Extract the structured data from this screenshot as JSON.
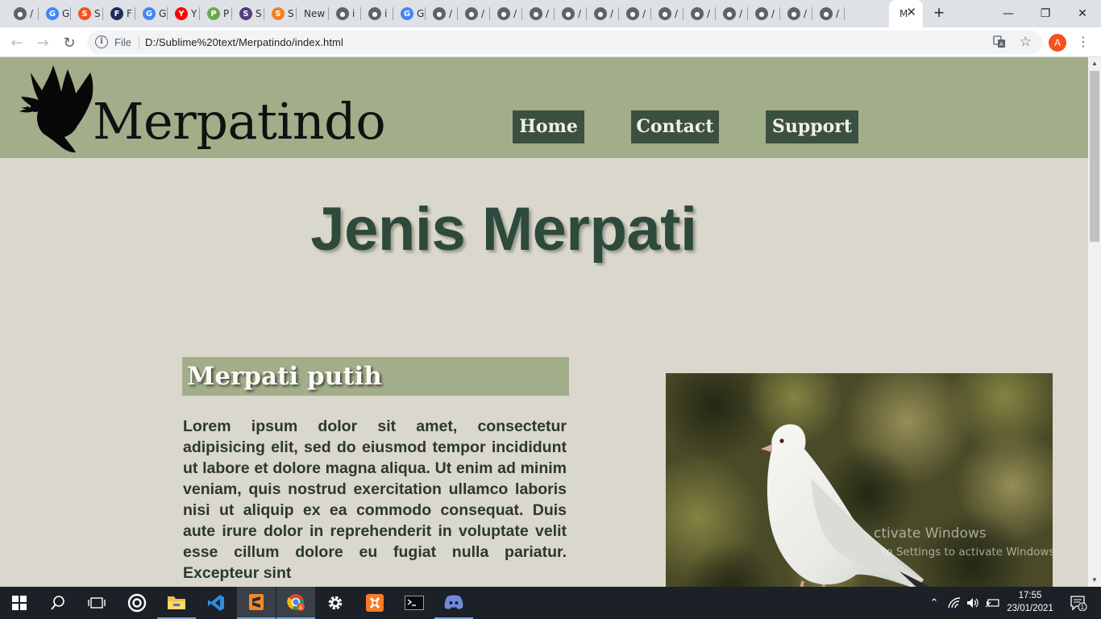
{
  "browser": {
    "tabs": [
      {
        "label": "/",
        "icon": "globe-icon",
        "color": "#5f6368"
      },
      {
        "label": "G",
        "icon": "google-icon",
        "color": "#4285f4"
      },
      {
        "label": "S",
        "icon": "flower-icon",
        "color": "#f4511e"
      },
      {
        "label": "F",
        "icon": "site-icon",
        "color": "#1f2d5c"
      },
      {
        "label": "G",
        "icon": "google-icon",
        "color": "#4285f4"
      },
      {
        "label": "Y",
        "icon": "youtube-icon",
        "color": "#ff0000"
      },
      {
        "label": "P",
        "icon": "px-icon",
        "color": "#6aa84f"
      },
      {
        "label": "S",
        "icon": "bootstrap-icon",
        "color": "#563d7c"
      },
      {
        "label": "S",
        "icon": "stackoverflow-icon",
        "color": "#f48024"
      },
      {
        "label": "New",
        "icon": "",
        "color": "#5f6368"
      },
      {
        "label": "i",
        "icon": "globe-icon",
        "color": "#5f6368"
      },
      {
        "label": "i",
        "icon": "globe-icon",
        "color": "#5f6368"
      },
      {
        "label": "G",
        "icon": "google-icon",
        "color": "#4285f4"
      },
      {
        "label": "/",
        "icon": "globe-icon",
        "color": "#5f6368"
      },
      {
        "label": "/",
        "icon": "globe-icon",
        "color": "#5f6368"
      },
      {
        "label": "/",
        "icon": "globe-icon",
        "color": "#5f6368"
      },
      {
        "label": "/",
        "icon": "globe-icon",
        "color": "#5f6368"
      },
      {
        "label": "/",
        "icon": "globe-icon",
        "color": "#5f6368"
      },
      {
        "label": "/",
        "icon": "globe-icon",
        "color": "#5f6368"
      },
      {
        "label": "/",
        "icon": "globe-icon",
        "color": "#5f6368"
      },
      {
        "label": "/",
        "icon": "globe-icon",
        "color": "#5f6368"
      },
      {
        "label": "/",
        "icon": "globe-icon",
        "color": "#5f6368"
      },
      {
        "label": "/",
        "icon": "globe-icon",
        "color": "#5f6368"
      },
      {
        "label": "/",
        "icon": "globe-icon",
        "color": "#5f6368"
      },
      {
        "label": "/",
        "icon": "globe-icon",
        "color": "#5f6368"
      },
      {
        "label": "/",
        "icon": "globe-icon",
        "color": "#5f6368"
      }
    ],
    "active_tab_label": "M",
    "scheme_label": "File",
    "url": "D:/Sublime%20text/Merpatindo/index.html",
    "profile_initial": "A"
  },
  "site": {
    "brand": "Merpatindo",
    "nav": [
      "Home",
      "Contact",
      "Support"
    ],
    "page_title": "Jenis Merpati",
    "section_title": "Merpati putih",
    "body_text": "Lorem ipsum dolor sit amet, consectetur adipisicing elit, sed do eiusmod tempor incididunt ut labore et dolore magna aliqua. Ut enim ad minim veniam, quis nostrud exercitation ullamco laboris nisi ut aliquip ex ea commodo consequat. Duis aute irure dolor in reprehenderit in voluptate velit esse cillum dolore eu fugiat nulla pariatur. Excepteur sint",
    "watermark_title": "ctivate Windows",
    "watermark_sub": "to Settings to activate Windows"
  },
  "taskbar": {
    "time": "17:55",
    "date": "23/01/2021",
    "notification_count": "1"
  },
  "colors": {
    "header_green": "#a2ae89",
    "nav_button": "#3c5040",
    "title_green": "#2d4a3c",
    "page_bg": "#dad7cc"
  }
}
